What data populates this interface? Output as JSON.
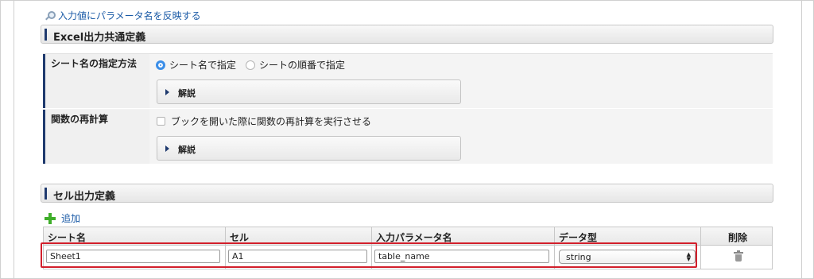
{
  "reflect_link": "入力値にパラメータ名を反映する",
  "section_excel": {
    "title": "Excel出力共通定義",
    "sheet_method": {
      "label": "シート名の指定方法",
      "options": [
        "シート名で指定",
        "シートの順番で指定"
      ],
      "selected": "シート名で指定",
      "explain_label": "解説"
    },
    "recalc": {
      "label": "関数の再計算",
      "checkbox_label": "ブックを開いた際に関数の再計算を実行させる",
      "checked": false,
      "explain_label": "解説"
    }
  },
  "section_cell": {
    "title": "セル出力定義",
    "add_label": "追加",
    "columns": [
      "シート名",
      "セル",
      "入力パラメータ名",
      "データ型",
      "削除"
    ],
    "rows": [
      {
        "sheet": "Sheet1",
        "cell": "A1",
        "param": "table_name",
        "type": "string"
      }
    ]
  },
  "colors": {
    "accent": "#1f3a6e",
    "highlight": "#d21f2b",
    "add": "#3fae2a",
    "link": "#1a5aa6"
  }
}
